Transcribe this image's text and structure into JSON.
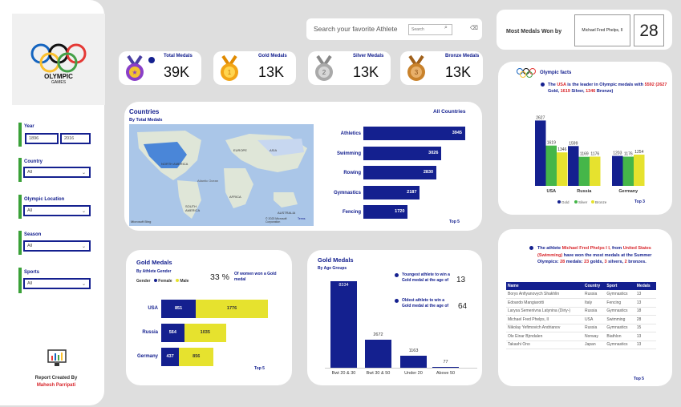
{
  "sidebar": {
    "logo_text": "OLYMPIC",
    "logo_sub": "GAMES",
    "year_label": "Year",
    "year_from": "1896",
    "year_to": "2016",
    "country_label": "Country",
    "country_value": "All",
    "location_label": "Olympic Location",
    "location_value": "All",
    "season_label": "Season",
    "season_value": "All",
    "sports_label": "Sports",
    "sports_value": "All",
    "report_by": "Report Created By",
    "author": "Mahesh Parripati"
  },
  "search": {
    "prompt": "Search your favorite Athlete",
    "placeholder": "Search"
  },
  "most_medals": {
    "label": "Most Medals Won by",
    "athlete": "Michael Fred Phelps, II",
    "count": "28"
  },
  "kpis": [
    {
      "label": "Total Medals",
      "value": "39K",
      "color": "#8a3fc8"
    },
    {
      "label": "Gold Medals",
      "value": "13K",
      "color": "#f2a516"
    },
    {
      "label": "Silver Medals",
      "value": "13K",
      "color": "#a9a9a9"
    },
    {
      "label": "Bronze Medals",
      "value": "13K",
      "color": "#c9822b"
    }
  ],
  "countries": {
    "title": "Countries",
    "subtitle": "By Total Medals",
    "filter_label": "All Countries",
    "map_labels": [
      "NORTH AMERICA",
      "EUROPE",
      "ASIA",
      "AFRICA",
      "SOUTH AMERICA",
      "AUSTRALIA",
      "Atlantic Ocean"
    ],
    "map_credit": "Microsoft Bing",
    "map_copy": "© 2023 Microsoft Corporation",
    "map_terms": "Terms",
    "top_label": "Top 5"
  },
  "sports_chart": {
    "chart_data": {
      "type": "bar",
      "categories": [
        "Athletics",
        "Swimming",
        "Rowing",
        "Gymnastics",
        "Fencing"
      ],
      "values": [
        3945,
        3026,
        2830,
        2187,
        1720
      ]
    }
  },
  "facts": {
    "title": "Olympic facts",
    "text_pre": "The",
    "text_usa": "USA",
    "text_mid": "is the leader in Olympic medals with",
    "text_total": "5592 (2627",
    "text_gold": "Gold,",
    "text_silver_n": "1619",
    "text_silver": "Silver,",
    "text_bronze_n": "1346",
    "text_bronze": "Bronze)",
    "top_label": "Top 3",
    "chart_data": {
      "type": "bar",
      "categories": [
        "USA",
        "Russia",
        "Germany"
      ],
      "series": [
        {
          "name": "Gold",
          "values": [
            2627,
            1599,
            1203
          ],
          "color": "#14208f"
        },
        {
          "name": "Silver",
          "values": [
            1619,
            1169,
            1176
          ],
          "color": "#45b649"
        },
        {
          "name": "Bronze",
          "values": [
            1346,
            1176,
            1254
          ],
          "color": "#e6e22e"
        }
      ],
      "ylim": [
        0,
        2800
      ]
    }
  },
  "gender": {
    "title": "Gold Medals",
    "subtitle": "By Athlete Gender",
    "legend_title": "Gender",
    "legend_female": "Female",
    "legend_male": "Male",
    "pct": "33 %",
    "pct_text": "Of women won a Gold medal",
    "top_label": "Top 5",
    "chart_data": {
      "type": "bar",
      "categories": [
        "USA",
        "Russia",
        "Germany"
      ],
      "series": [
        {
          "name": "Female",
          "values": [
            851,
            564,
            437
          ],
          "color": "#14208f"
        },
        {
          "name": "Male",
          "values": [
            1776,
            1035,
            856
          ],
          "color": "#e6e22e"
        }
      ]
    }
  },
  "age": {
    "title": "Gold Medals",
    "subtitle": "By Age Groups",
    "youngest_text": "Youngest athlete to win a Gold medal at the age of",
    "youngest_val": "13",
    "oldest_text": "Oldest athlete to win a Gold medal at the age of",
    "oldest_val": "64",
    "chart_data": {
      "type": "bar",
      "categories": [
        "Bwt 20 & 30",
        "Bwt 30 & 50",
        "Under 20",
        "Above 50"
      ],
      "values": [
        8334,
        2672,
        1163,
        77
      ]
    }
  },
  "athlete": {
    "text_pre": "The athlete",
    "name": "Michael Fred Phelps I I,",
    "text_from": "from",
    "country": "United States (Swimming)",
    "text_mid": "have won the most medals at the Summer Olympics:",
    "n_total": "28",
    "text_medals": "medals:",
    "n_gold": "23",
    "text_golds": "golds,",
    "n_silver": "3",
    "text_silvers": "silvers,",
    "n_bronze": "2",
    "text_bronzes": "bronzes.",
    "columns": [
      "Name",
      "Country",
      "Sport",
      "Medals"
    ],
    "rows": [
      [
        "Borys Anfiyanovych Shakhlin",
        "Russia",
        "Gymnastics",
        "13"
      ],
      [
        "Edoardo Mangiarotti",
        "Italy",
        "Fencing",
        "13"
      ],
      [
        "Larysa Semenivna Latynina (Diriy-)",
        "Russia",
        "Gymnastics",
        "18"
      ],
      [
        "Michael Fred Phelps, II",
        "USA",
        "Swimming",
        "28"
      ],
      [
        "Nikolay Yefimovich Andrianov",
        "Russia",
        "Gymnastics",
        "15"
      ],
      [
        "Ole Einar Bjrndalen",
        "Norway",
        "Biathlon",
        "13"
      ],
      [
        "Takashi Ono",
        "Japan",
        "Gymnastics",
        "13"
      ]
    ],
    "top_label": "Top 5"
  }
}
